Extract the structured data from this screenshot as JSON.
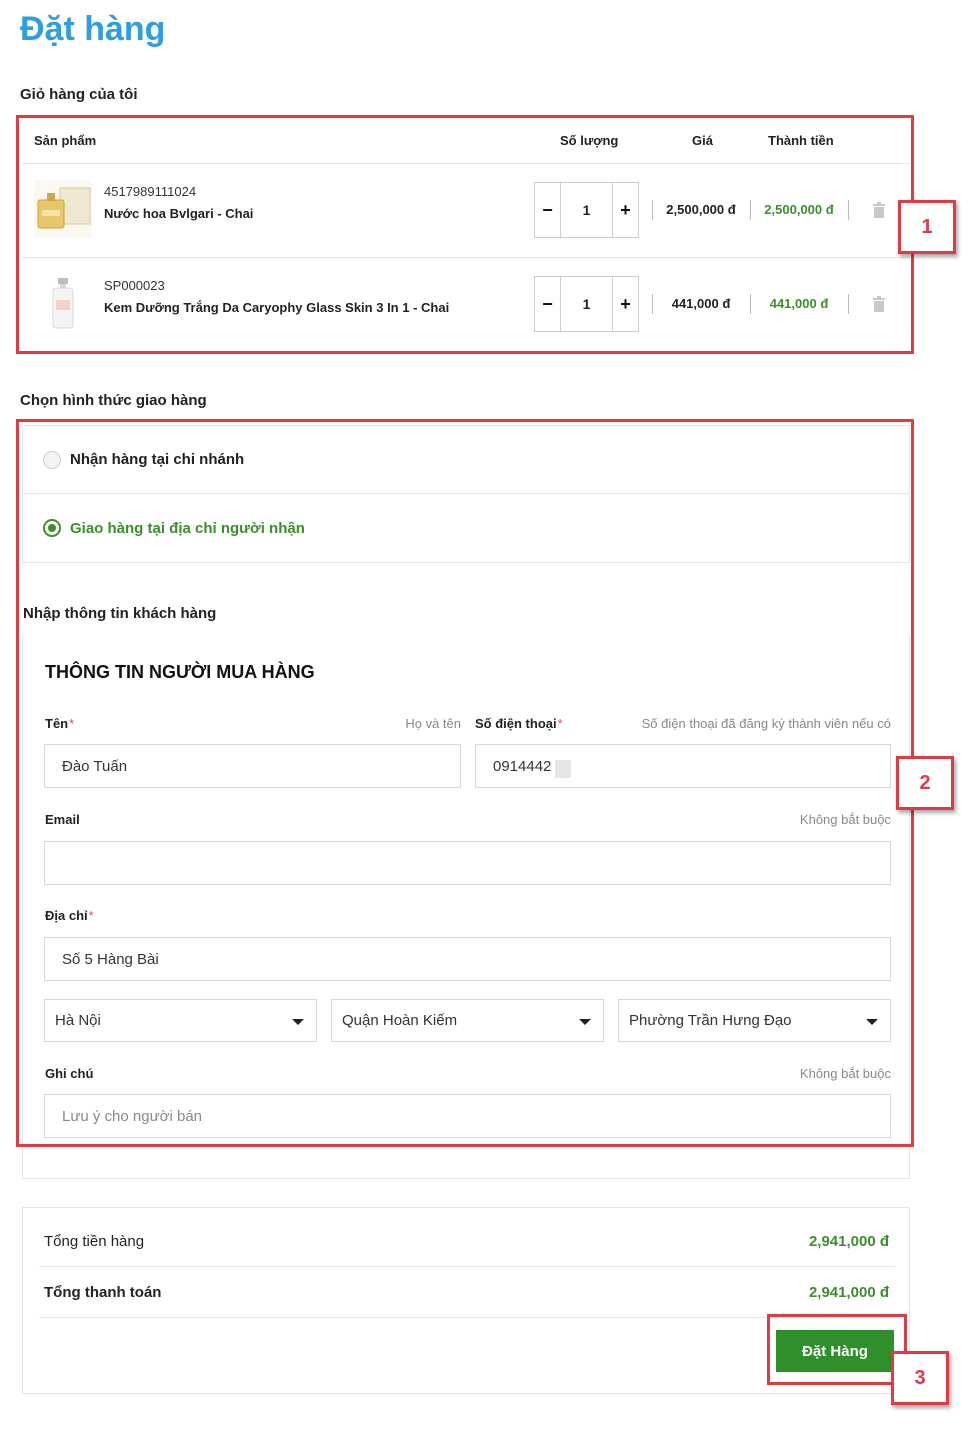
{
  "page": {
    "title": "Đặt hàng"
  },
  "cart": {
    "section_label": "Giỏ hàng của tôi",
    "columns": {
      "product": "Sản phẩm",
      "quantity": "Số lượng",
      "price": "Giá",
      "total": "Thành tiền"
    },
    "items": [
      {
        "sku": "4517989111024",
        "name": "Nước hoa Bvlgari - Chai",
        "quantity": "1",
        "price": "2,500,000 đ",
        "total": "2,500,000 đ"
      },
      {
        "sku": "SP000023",
        "name": "Kem Dưỡng Trắng Da Caryophy Glass Skin 3 In 1 - Chai",
        "quantity": "1",
        "price": "441,000 đ",
        "total": "441,000 đ"
      }
    ],
    "minus_symbol": "−",
    "plus_symbol": "+"
  },
  "shipping": {
    "section_label": "Chọn hình thức giao hàng",
    "options": [
      {
        "label": "Nhận hàng tại chi nhánh",
        "selected": false
      },
      {
        "label": "Giao hàng tại địa chỉ người nhận",
        "selected": true
      }
    ]
  },
  "customer": {
    "section_label": "Nhập thông tin khách hàng",
    "form_title": "THÔNG TIN NGƯỜI MUA HÀNG",
    "name": {
      "label": "Tên",
      "hint": "Họ và tên",
      "value": "Đào Tuấn"
    },
    "phone": {
      "label": "Số điện thoại",
      "hint": "Số điện thoại đã đăng ký thành viên nếu có",
      "value": "0914442"
    },
    "email": {
      "label": "Email",
      "hint": "Không bắt buộc",
      "value": ""
    },
    "address": {
      "label": "Địa chỉ",
      "value": "Số 5 Hàng Bài",
      "province": "Hà Nội",
      "district": "Quận Hoàn Kiếm",
      "ward": "Phường Trần Hưng Đạo"
    },
    "note": {
      "label": "Ghi chú",
      "hint": "Không bắt buộc",
      "placeholder": "Lưu ý cho người bán"
    },
    "required_mark": "*"
  },
  "summary": {
    "subtotal_label": "Tổng tiền hàng",
    "subtotal_value": "2,941,000 đ",
    "grand_total_label": "Tổng thanh toán",
    "grand_total_value": "2,941,000 đ",
    "order_button": "Đặt Hàng"
  },
  "annotations": [
    {
      "label": "1"
    },
    {
      "label": "2"
    },
    {
      "label": "3"
    }
  ],
  "colors": {
    "title_blue": "#2e9ee0",
    "accent_green": "#3a8f2a",
    "button_green": "#2f8f2a",
    "annotation_red": "#e03b43",
    "required_red": "#d9534f"
  }
}
